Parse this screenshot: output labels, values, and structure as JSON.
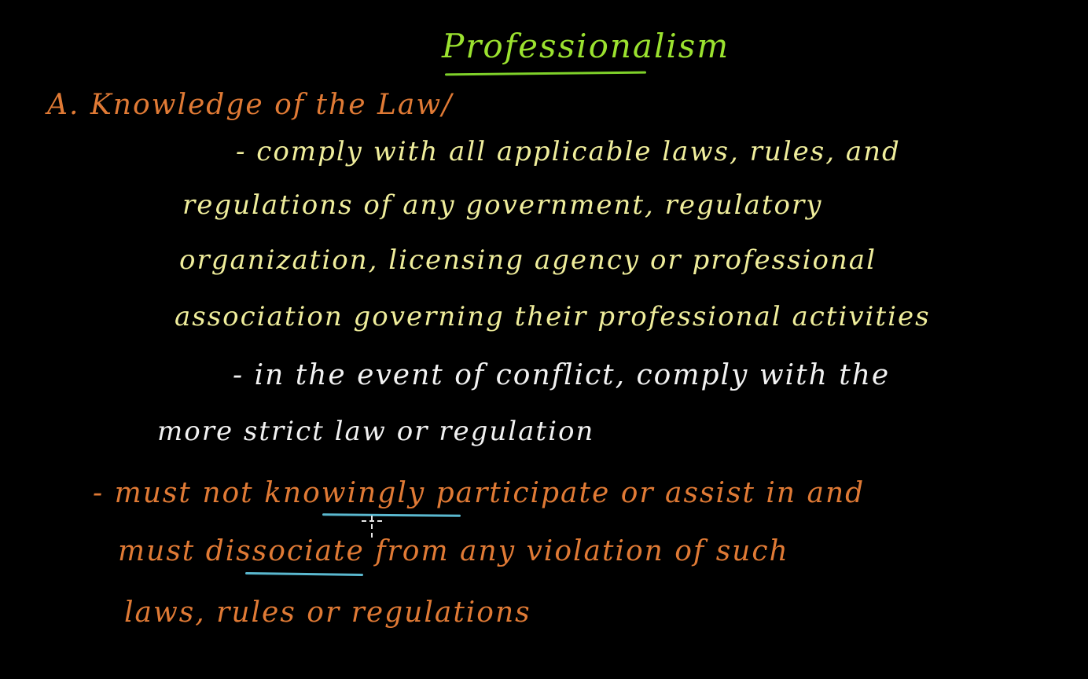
{
  "title": "Professionalism",
  "section_heading": "A. Knowledge of the Law/",
  "paragraph_1": {
    "line_1": "- comply with all applicable laws, rules, and",
    "line_2": "regulations of any government, regulatory",
    "line_3": "organization, licensing agency or professional",
    "line_4": "association governing their professional activities"
  },
  "paragraph_2": {
    "line_1": "- in the event of conflict, comply with the",
    "line_2": "more strict law or regulation"
  },
  "paragraph_3": {
    "line_1_pre": "- must not ",
    "line_1_emph": "knowingly",
    "line_1_post": " participate or assist in and",
    "line_2_pre": "must ",
    "line_2_emph": "dissociate",
    "line_2_post": " from any violation of such",
    "line_3": "laws, rules or regulations"
  },
  "colors": {
    "background": "#000000",
    "title": "#9be22f",
    "heading_orange": "#e07a35",
    "text_yellow": "#f0ee9c",
    "text_white": "#f2f2f2",
    "underline_blue": "#5ab8cf"
  }
}
